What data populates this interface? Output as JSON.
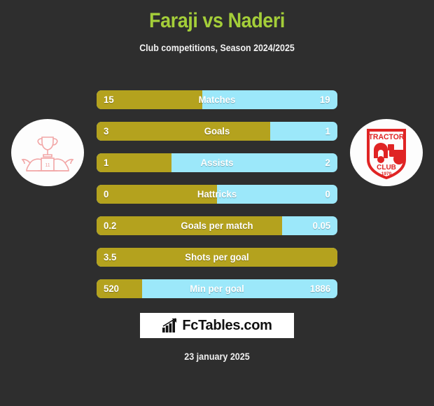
{
  "header": {
    "title": "Faraji vs Naderi",
    "subtitle": "Club competitions, Season 2024/2025",
    "title_color": "#a4ce39"
  },
  "colors": {
    "background": "#2e2e2e",
    "home_bar": "#b4a21e",
    "away_bar": "#9ce8fa",
    "text": "#ffffff"
  },
  "logos": {
    "home": {
      "name": "trophy-lions-crest",
      "alt": "Trophy and lions crest"
    },
    "away": {
      "name": "tractor-club-crest",
      "alt": "Tractor Club crest",
      "word_top": "TRACTOR",
      "word_mid": "CLUB",
      "word_year": "1970"
    }
  },
  "chart_data": {
    "type": "bar",
    "title": "Faraji vs Naderi",
    "subtitle": "Club competitions, Season 2024/2025",
    "orientation": "horizontal-diverging",
    "legend": [
      "Faraji",
      "Naderi"
    ],
    "categories": [
      "Matches",
      "Goals",
      "Assists",
      "Hattricks",
      "Goals per match",
      "Shots per goal",
      "Min per goal"
    ],
    "series": [
      {
        "name": "Faraji",
        "color": "#b4a21e",
        "values": [
          15,
          3,
          1,
          0,
          0.2,
          3.5,
          520
        ]
      },
      {
        "name": "Naderi",
        "color": "#9ce8fa",
        "values": [
          19,
          1,
          2,
          0,
          0.05,
          null,
          1886
        ]
      }
    ],
    "rows": [
      {
        "label": "Matches",
        "home": "15",
        "away": "19",
        "home_pct": 44
      },
      {
        "label": "Goals",
        "home": "3",
        "away": "1",
        "home_pct": 72
      },
      {
        "label": "Assists",
        "home": "1",
        "away": "2",
        "home_pct": 31
      },
      {
        "label": "Hattricks",
        "home": "0",
        "away": "0",
        "home_pct": 50
      },
      {
        "label": "Goals per match",
        "home": "0.2",
        "away": "0.05",
        "home_pct": 77
      },
      {
        "label": "Shots per goal",
        "home": "3.5",
        "away": "",
        "home_pct": 100
      },
      {
        "label": "Min per goal",
        "home": "520",
        "away": "1886",
        "home_pct": 19
      }
    ]
  },
  "footer": {
    "brand": "FcTables.com",
    "date": "23 january 2025"
  }
}
